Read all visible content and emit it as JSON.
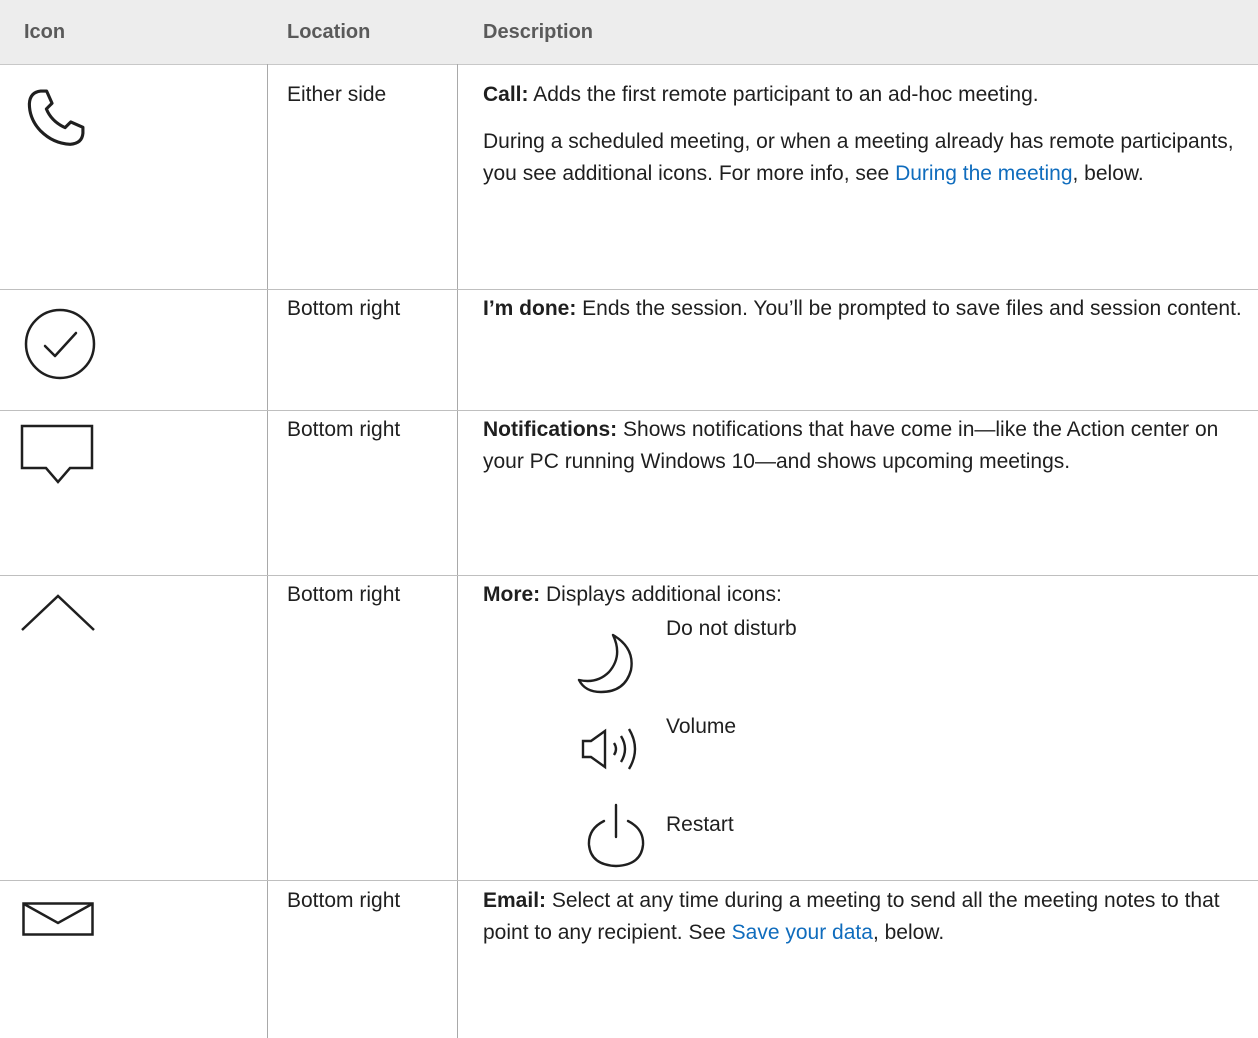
{
  "headers": {
    "icon": "Icon",
    "location": "Location",
    "description": "Description"
  },
  "rows": [
    {
      "icon": "phone-icon",
      "location": "Either side",
      "title": "Call:",
      "text": " Adds the first remote participant to an ad-hoc meeting.",
      "para2_text": "During a scheduled meeting, or when a meeting already has remote participants, you see additional icons. For more info, see ",
      "para2_link": "During the meeting",
      "para2_after": ", below."
    },
    {
      "icon": "checkmark-circle-icon",
      "location": "Bottom right",
      "title": "I’m done:",
      "text": " Ends the session. You’ll be prompted to save files and session content."
    },
    {
      "icon": "chat-bubble-icon",
      "location": "Bottom right",
      "title": "Notifications:",
      "text": " Shows notifications that have come in—like the Action center on your PC running Windows 10—and shows upcoming meetings."
    },
    {
      "icon": "chevron-up-icon",
      "location": "Bottom right",
      "title": "More:",
      "text": " Displays additional icons:",
      "subitems": [
        {
          "icon": "moon-icon",
          "label": "Do not disturb"
        },
        {
          "icon": "speaker-icon",
          "label": "Volume"
        },
        {
          "icon": "power-icon",
          "label": "Restart"
        }
      ]
    },
    {
      "icon": "envelope-icon",
      "location": "Bottom right",
      "title": "Email:",
      "text": " Select at any time during a meeting to send all the meeting notes to that point to any recipient. See ",
      "link": "Save your data",
      "after": ", below."
    }
  ],
  "colors": {
    "header_bg": "#ededed",
    "link": "#0f6cbd",
    "grid": "#a9a9a9"
  }
}
